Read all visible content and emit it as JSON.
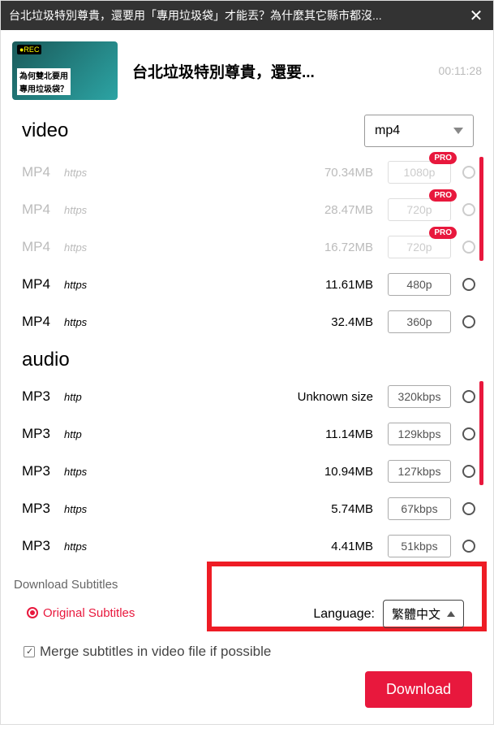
{
  "titlebar": {
    "text": "台北垃圾特別尊貴，還要用「專用垃圾袋」才能丟？為什麼其它縣市都沒..."
  },
  "header": {
    "title": "台北垃圾特別尊貴，還要...",
    "duration": "00:11:28",
    "thumb_line1": "為何雙北要用",
    "thumb_line2": "專用垃圾袋？"
  },
  "sections": {
    "video_label": "video",
    "audio_label": "audio"
  },
  "format_select": {
    "value": "mp4"
  },
  "pro_label": "PRO",
  "video_rows": [
    {
      "fmt": "MP4",
      "proto": "https",
      "size": "70.34MB",
      "quality": "1080p",
      "pro": true
    },
    {
      "fmt": "MP4",
      "proto": "https",
      "size": "28.47MB",
      "quality": "720p",
      "pro": true
    },
    {
      "fmt": "MP4",
      "proto": "https",
      "size": "16.72MB",
      "quality": "720p",
      "pro": true
    },
    {
      "fmt": "MP4",
      "proto": "https",
      "size": "11.61MB",
      "quality": "480p",
      "pro": false
    },
    {
      "fmt": "MP4",
      "proto": "https",
      "size": "32.4MB",
      "quality": "360p",
      "pro": false
    }
  ],
  "audio_rows": [
    {
      "fmt": "MP3",
      "proto": "http",
      "size": "Unknown size",
      "quality": "320kbps"
    },
    {
      "fmt": "MP3",
      "proto": "http",
      "size": "11.14MB",
      "quality": "129kbps"
    },
    {
      "fmt": "MP3",
      "proto": "https",
      "size": "10.94MB",
      "quality": "127kbps"
    },
    {
      "fmt": "MP3",
      "proto": "https",
      "size": "5.74MB",
      "quality": "67kbps"
    },
    {
      "fmt": "MP3",
      "proto": "https",
      "size": "4.41MB",
      "quality": "51kbps"
    }
  ],
  "subtitles": {
    "title": "Download Subtitles",
    "original_label": "Original Subtitles",
    "language_label": "Language:",
    "language_value": "繁體中文",
    "merge_label": "Merge subtitles in video file if possible"
  },
  "download_label": "Download"
}
